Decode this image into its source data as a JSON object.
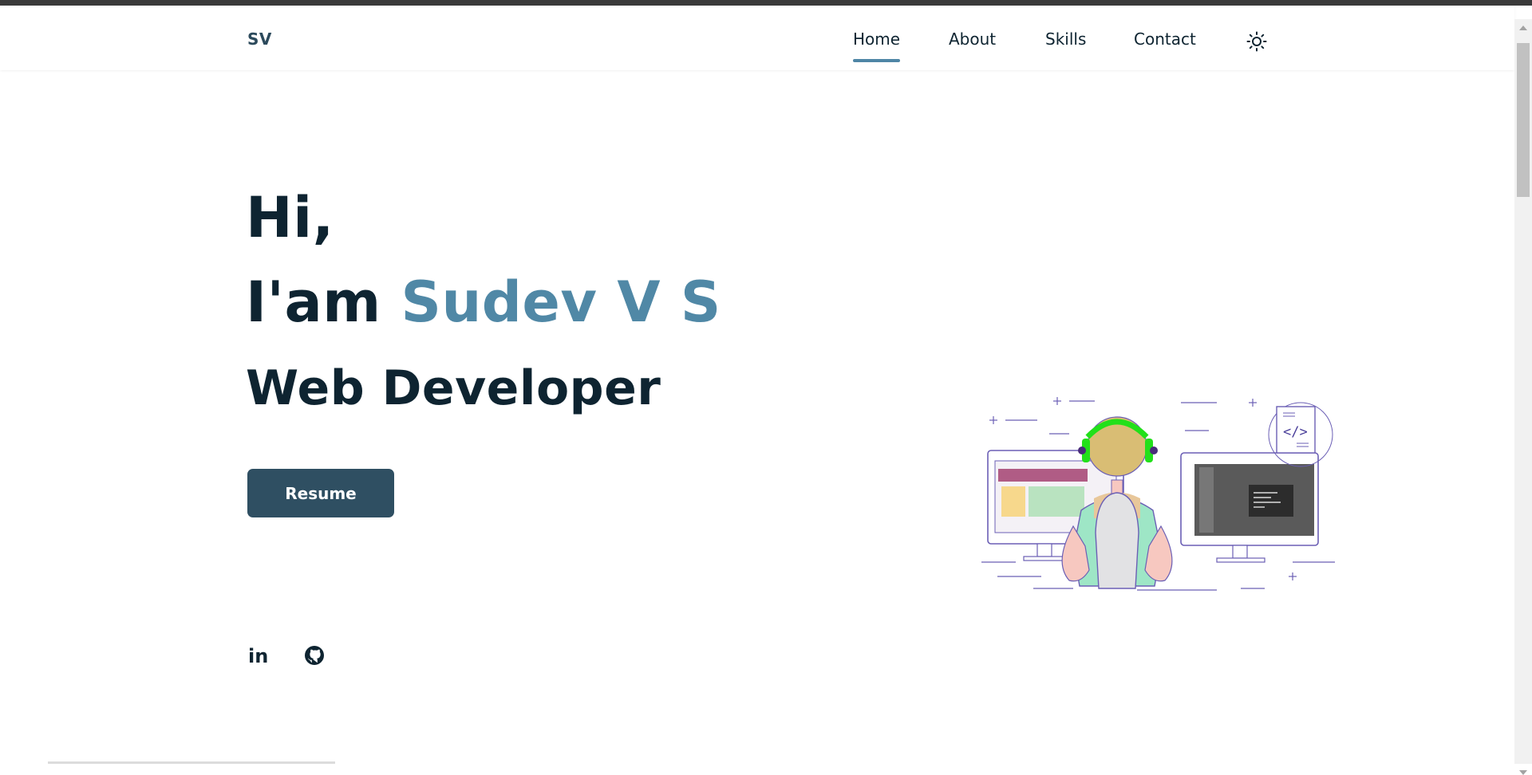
{
  "header": {
    "logo": "SV",
    "nav": [
      {
        "label": "Home",
        "active": true
      },
      {
        "label": "About",
        "active": false
      },
      {
        "label": "Skills",
        "active": false
      },
      {
        "label": "Contact",
        "active": false
      }
    ],
    "theme_icon": "sun-icon"
  },
  "hero": {
    "greeting": "Hi,",
    "intro_prefix": "I'am",
    "name": "Sudev V S",
    "role": "Web Developer",
    "resume_label": "Resume"
  },
  "social": {
    "linkedin_label": "in",
    "github_icon": "github-icon"
  },
  "illustration": {
    "code_tag": "</>",
    "icon": "developer-at-desk-illustration"
  },
  "colors": {
    "accent": "#5088a6",
    "dark_text": "#0e2431",
    "button_bg": "#2f4f62",
    "headphones": "#22e01a"
  }
}
